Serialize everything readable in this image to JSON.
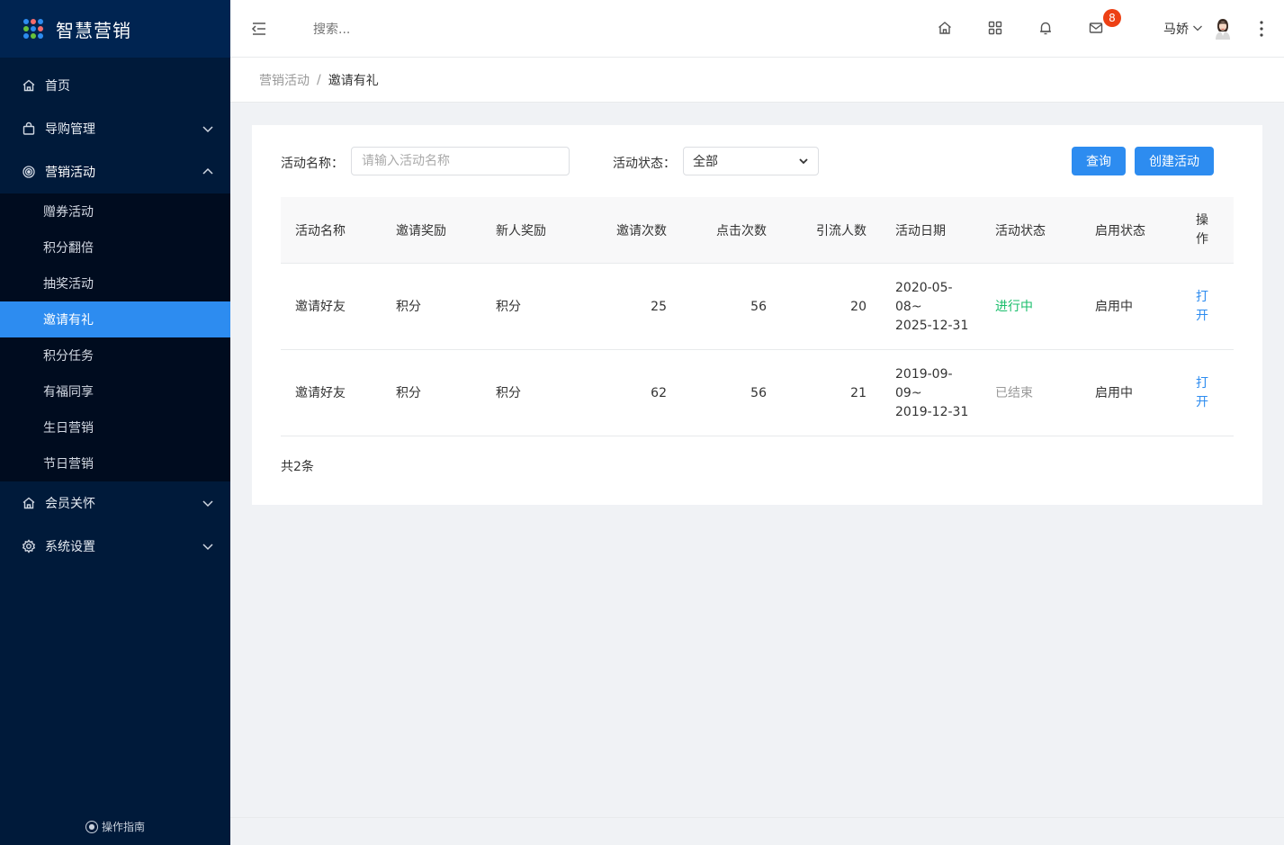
{
  "app": {
    "logo_text": "智慧营销"
  },
  "sidebar": {
    "items": [
      {
        "label": "首页",
        "icon": "home-icon"
      },
      {
        "label": "导购管理",
        "icon": "bag-icon"
      },
      {
        "label": "营销活动",
        "icon": "target-icon"
      },
      {
        "label": "会员关怀",
        "icon": "house-icon"
      },
      {
        "label": "系统设置",
        "icon": "gear-icon"
      }
    ],
    "submenu": [
      "赠券活动",
      "积分翻倍",
      "抽奖活动",
      "邀请有礼",
      "积分任务",
      "有福同享",
      "生日营销",
      "节日营销"
    ],
    "active_sub": "邀请有礼",
    "guide_label": "操作指南"
  },
  "header": {
    "search_placeholder": "搜索...",
    "mail_badge": "8",
    "username": "马娇"
  },
  "breadcrumb": {
    "parent": "营销活动",
    "separator": "/",
    "current": "邀请有礼"
  },
  "filters": {
    "name_label": "活动名称：",
    "name_placeholder": "请输入活动名称",
    "status_label": "活动状态：",
    "status_value": "全部",
    "query_button": "查询",
    "create_button": "创建活动"
  },
  "table": {
    "columns": [
      "活动名称",
      "邀请奖励",
      "新人奖励",
      "邀请次数",
      "点击次数",
      "引流人数",
      "活动日期",
      "活动状态",
      "启用状态",
      "操作"
    ],
    "rows": [
      {
        "name": "邀请好友",
        "invite_reward": "积分",
        "new_reward": "积分",
        "invites": "25",
        "clicks": "56",
        "traffic": "20",
        "date_l1": "2020-05-",
        "date_l2": "08~",
        "date_l3": "2025-12-31",
        "status": "进行中",
        "enabled": "启用中",
        "action": "打开"
      },
      {
        "name": "邀请好友",
        "invite_reward": "积分",
        "new_reward": "积分",
        "invites": "62",
        "clicks": "56",
        "traffic": "21",
        "date_l1": "2019-09-",
        "date_l2": "09~",
        "date_l3": "2019-12-31",
        "status": "已结束",
        "enabled": "启用中",
        "action": "打开"
      }
    ],
    "total": "共2条"
  }
}
